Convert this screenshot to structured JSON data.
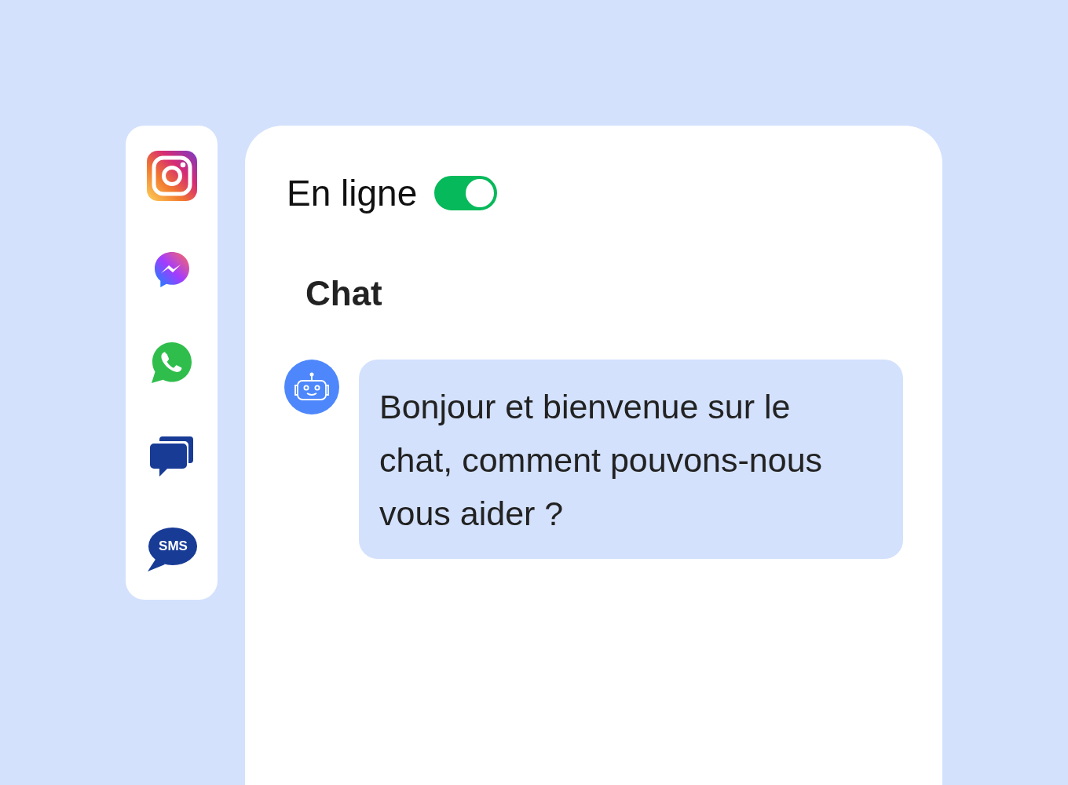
{
  "sidebar": {
    "channels": [
      {
        "kind": "instagram"
      },
      {
        "kind": "messenger"
      },
      {
        "kind": "whatsapp"
      },
      {
        "kind": "chat"
      },
      {
        "kind": "sms",
        "label": "SMS"
      }
    ]
  },
  "status": {
    "label": "En ligne",
    "on": true
  },
  "chat": {
    "title": "Chat",
    "messages": [
      {
        "kind": "bot",
        "text": "Bonjour et bienvenue sur le chat, comment pouvons-nous vous aider ?"
      }
    ]
  }
}
